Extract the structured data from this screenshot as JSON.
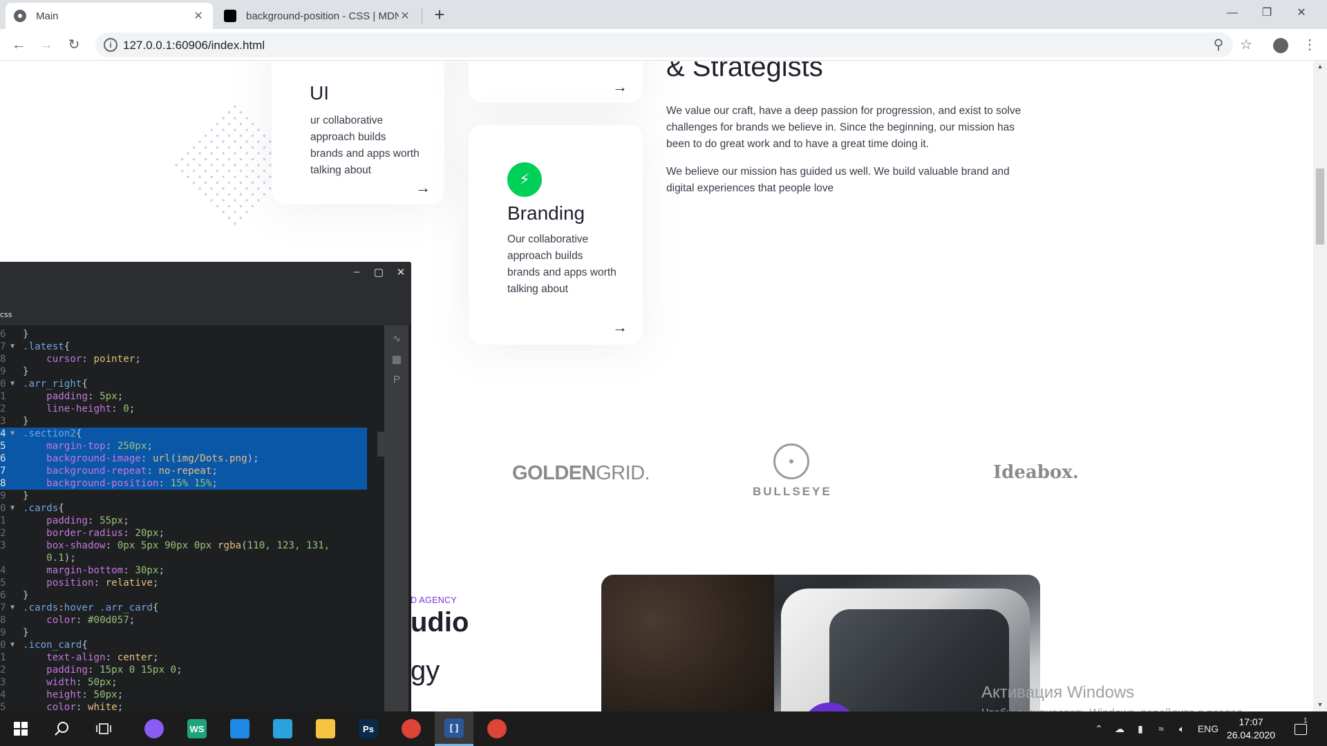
{
  "browser": {
    "tabs": [
      {
        "title": "Main",
        "active": true
      },
      {
        "title": "background-position - CSS | MDN",
        "active": false
      }
    ],
    "url": "127.0.0.1:60906/index.html",
    "new_tab": "+",
    "close": "✕"
  },
  "page": {
    "card_ui": {
      "title": "UI",
      "text": "ur collaborative approach builds brands and apps worth talking about",
      "arrow": "→"
    },
    "card_top2": {
      "arrow": "→"
    },
    "card_branding": {
      "title": "Branding",
      "text": "Our collaborative approach builds brands and apps worth talking about",
      "arrow": "→",
      "icon": "bolt-icon"
    },
    "strategists": {
      "heading": "& Strategists",
      "paragraph1": "We value our craft, have a deep passion for progression, and exist to solve challenges for brands we believe in. Since the beginning, our mission has been to do great work and to have a great time doing it.",
      "paragraph2": "We believe our mission has guided us well. We build valuable brand and digital experiences that people love"
    },
    "logos": {
      "golden_bold": "GOLDEN",
      "golden_light": "GRID.",
      "bullseye": "BULLSEYE",
      "ideabox": "Ideabox."
    },
    "agency_label": "D AGENCY",
    "studio_line1": "udio",
    "studio_line2": "gy",
    "accent_green": "#00d057",
    "accent_purple": "#7b2fd6"
  },
  "windows_activation": {
    "title": "Активация Windows",
    "text": "Чтобы активировать Windows, перейдите в раздел \"Параметры\"."
  },
  "editor": {
    "file_tab": "css",
    "lines": [
      {
        "n": "6",
        "fold": "",
        "tokens": [
          [
            "c-punc",
            "}"
          ]
        ]
      },
      {
        "n": "7",
        "fold": "▼",
        "tokens": [
          [
            "c-sel",
            ".latest"
          ],
          [
            "c-punc",
            "{"
          ]
        ]
      },
      {
        "n": "8",
        "fold": "",
        "tokens": [
          [
            "c-punc",
            "    "
          ],
          [
            "c-prop",
            "cursor"
          ],
          [
            "c-punc",
            ": "
          ],
          [
            "c-val",
            "pointer"
          ],
          [
            "c-punc",
            ";"
          ]
        ]
      },
      {
        "n": "9",
        "fold": "",
        "tokens": [
          [
            "c-punc",
            "}"
          ]
        ]
      },
      {
        "n": "0",
        "fold": "▼",
        "tokens": [
          [
            "c-sel",
            ".arr_right"
          ],
          [
            "c-punc",
            "{"
          ]
        ]
      },
      {
        "n": "1",
        "fold": "",
        "tokens": [
          [
            "c-punc",
            "    "
          ],
          [
            "c-prop",
            "padding"
          ],
          [
            "c-punc",
            ": "
          ],
          [
            "c-num",
            "5px"
          ],
          [
            "c-punc",
            ";"
          ]
        ]
      },
      {
        "n": "2",
        "fold": "",
        "tokens": [
          [
            "c-punc",
            "    "
          ],
          [
            "c-prop",
            "line-height"
          ],
          [
            "c-punc",
            ": "
          ],
          [
            "c-num",
            "0"
          ],
          [
            "c-punc",
            ";"
          ]
        ]
      },
      {
        "n": "3",
        "fold": "",
        "tokens": [
          [
            "c-punc",
            "}"
          ]
        ]
      },
      {
        "n": "4",
        "fold": "▼",
        "sel": true,
        "tokens": [
          [
            "c-sel",
            ".section2"
          ],
          [
            "c-punc",
            "{"
          ]
        ]
      },
      {
        "n": "5",
        "fold": "",
        "sel": true,
        "tokens": [
          [
            "c-punc",
            "    "
          ],
          [
            "c-prop",
            "margin-top"
          ],
          [
            "c-punc",
            ": "
          ],
          [
            "c-num",
            "250px"
          ],
          [
            "c-punc",
            ";"
          ]
        ]
      },
      {
        "n": "6",
        "fold": "",
        "sel": true,
        "tokens": [
          [
            "c-punc",
            "    "
          ],
          [
            "c-prop",
            "background-image"
          ],
          [
            "c-punc",
            ": "
          ],
          [
            "c-val",
            "url"
          ],
          [
            "c-punc",
            "("
          ],
          [
            "c-str",
            "img/Dots.png"
          ],
          [
            "c-punc",
            ");"
          ]
        ]
      },
      {
        "n": "7",
        "fold": "",
        "sel": true,
        "tokens": [
          [
            "c-punc",
            "    "
          ],
          [
            "c-prop",
            "background-repeat"
          ],
          [
            "c-punc",
            ": "
          ],
          [
            "c-val",
            "no-repeat"
          ],
          [
            "c-punc",
            ";"
          ]
        ]
      },
      {
        "n": "8",
        "fold": "",
        "sel": true,
        "tokens": [
          [
            "c-punc",
            "    "
          ],
          [
            "c-prop",
            "background-position"
          ],
          [
            "c-punc",
            ": "
          ],
          [
            "c-num",
            "15% 15%"
          ],
          [
            "c-punc",
            ";"
          ]
        ]
      },
      {
        "n": "9",
        "fold": "",
        "tokens": [
          [
            "c-punc",
            "}"
          ]
        ]
      },
      {
        "n": "0",
        "fold": "▼",
        "tokens": [
          [
            "c-sel",
            ".cards"
          ],
          [
            "c-punc",
            "{"
          ]
        ]
      },
      {
        "n": "1",
        "fold": "",
        "tokens": [
          [
            "c-punc",
            "    "
          ],
          [
            "c-prop",
            "padding"
          ],
          [
            "c-punc",
            ": "
          ],
          [
            "c-num",
            "55px"
          ],
          [
            "c-punc",
            ";"
          ]
        ]
      },
      {
        "n": "2",
        "fold": "",
        "tokens": [
          [
            "c-punc",
            "    "
          ],
          [
            "c-prop",
            "border-radius"
          ],
          [
            "c-punc",
            ": "
          ],
          [
            "c-num",
            "20px"
          ],
          [
            "c-punc",
            ";"
          ]
        ]
      },
      {
        "n": "3",
        "fold": "",
        "tokens": [
          [
            "c-punc",
            "    "
          ],
          [
            "c-prop",
            "box-shadow"
          ],
          [
            "c-punc",
            ": "
          ],
          [
            "c-num",
            "0px 5px 90px 0px "
          ],
          [
            "c-val",
            "rgba"
          ],
          [
            "c-punc",
            "("
          ],
          [
            "c-num",
            "110, 123, 131,"
          ]
        ]
      },
      {
        "n": "",
        "fold": "",
        "tokens": [
          [
            "c-punc",
            "    "
          ],
          [
            "c-num",
            "0.1"
          ],
          [
            "c-punc",
            ");"
          ]
        ]
      },
      {
        "n": "4",
        "fold": "",
        "tokens": [
          [
            "c-punc",
            "    "
          ],
          [
            "c-prop",
            "margin-bottom"
          ],
          [
            "c-punc",
            ": "
          ],
          [
            "c-num",
            "30px"
          ],
          [
            "c-punc",
            ";"
          ]
        ]
      },
      {
        "n": "5",
        "fold": "",
        "tokens": [
          [
            "c-punc",
            "    "
          ],
          [
            "c-prop",
            "position"
          ],
          [
            "c-punc",
            ": "
          ],
          [
            "c-val",
            "relative"
          ],
          [
            "c-punc",
            ";"
          ]
        ]
      },
      {
        "n": "6",
        "fold": "",
        "tokens": [
          [
            "c-punc",
            "}"
          ]
        ]
      },
      {
        "n": "7",
        "fold": "▼",
        "tokens": [
          [
            "c-sel",
            ".cards"
          ],
          [
            "c-punc",
            ":"
          ],
          [
            "c-sel",
            "hover .arr_card"
          ],
          [
            "c-punc",
            "{"
          ]
        ]
      },
      {
        "n": "8",
        "fold": "",
        "tokens": [
          [
            "c-punc",
            "    "
          ],
          [
            "c-prop",
            "color"
          ],
          [
            "c-punc",
            ": "
          ],
          [
            "c-num",
            "#00d057"
          ],
          [
            "c-punc",
            ";"
          ]
        ]
      },
      {
        "n": "9",
        "fold": "",
        "tokens": [
          [
            "c-punc",
            "}"
          ]
        ]
      },
      {
        "n": "0",
        "fold": "▼",
        "tokens": [
          [
            "c-sel",
            ".icon_card"
          ],
          [
            "c-punc",
            "{"
          ]
        ]
      },
      {
        "n": "1",
        "fold": "",
        "tokens": [
          [
            "c-punc",
            "    "
          ],
          [
            "c-prop",
            "text-align"
          ],
          [
            "c-punc",
            ": "
          ],
          [
            "c-val",
            "center"
          ],
          [
            "c-punc",
            ";"
          ]
        ]
      },
      {
        "n": "2",
        "fold": "",
        "tokens": [
          [
            "c-punc",
            "    "
          ],
          [
            "c-prop",
            "padding"
          ],
          [
            "c-punc",
            ": "
          ],
          [
            "c-num",
            "15px 0 15px 0"
          ],
          [
            "c-punc",
            ";"
          ]
        ]
      },
      {
        "n": "3",
        "fold": "",
        "tokens": [
          [
            "c-punc",
            "    "
          ],
          [
            "c-prop",
            "width"
          ],
          [
            "c-punc",
            ": "
          ],
          [
            "c-num",
            "50px"
          ],
          [
            "c-punc",
            ";"
          ]
        ]
      },
      {
        "n": "4",
        "fold": "",
        "tokens": [
          [
            "c-punc",
            "    "
          ],
          [
            "c-prop",
            "height"
          ],
          [
            "c-punc",
            ": "
          ],
          [
            "c-num",
            "50px"
          ],
          [
            "c-punc",
            ";"
          ]
        ]
      },
      {
        "n": "5",
        "fold": "",
        "tokens": [
          [
            "c-punc",
            "    "
          ],
          [
            "c-prop",
            "color"
          ],
          [
            "c-punc",
            ": "
          ],
          [
            "c-val",
            "white"
          ],
          [
            "c-punc",
            ";"
          ]
        ]
      }
    ]
  },
  "taskbar": {
    "apps": [
      {
        "name": "alice-icon",
        "label": "",
        "bg": "#8a5cf6"
      },
      {
        "name": "webstorm-icon",
        "label": "WS",
        "bg": "#1fa37b"
      },
      {
        "name": "vscode-icon",
        "label": "",
        "bg": "#1e88e5"
      },
      {
        "name": "telegram-icon",
        "label": "",
        "bg": "#2aa3de"
      },
      {
        "name": "file-explorer-icon",
        "label": "",
        "bg": "#f5c542"
      },
      {
        "name": "photoshop-icon",
        "label": "Ps",
        "bg": "#0a2a4a"
      },
      {
        "name": "chrome-icon",
        "label": "",
        "bg": "#db4437"
      },
      {
        "name": "brackets-icon",
        "label": "[ ]",
        "bg": "#2b5797"
      },
      {
        "name": "chrome-icon-2",
        "label": "",
        "bg": "#db4437"
      }
    ],
    "language": "ENG",
    "time": "17:07",
    "date": "26.04.2020",
    "notification_count": "1"
  }
}
